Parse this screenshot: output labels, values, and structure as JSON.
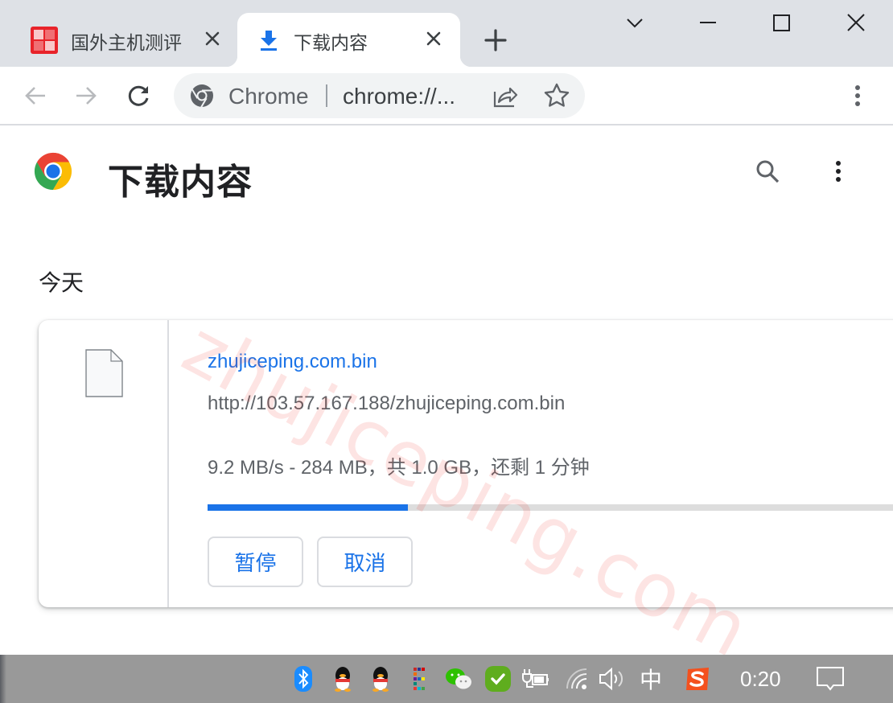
{
  "tabs": [
    {
      "title": "国外主机测评",
      "icon": "site-favicon",
      "active": false
    },
    {
      "title": "下载内容",
      "icon": "download-icon",
      "active": true
    }
  ],
  "window_controls": [
    "tab-search",
    "minimize",
    "maximize",
    "close"
  ],
  "toolbar": {
    "omnibox_chip": "Chrome",
    "omnibox_url": "chrome://..."
  },
  "page": {
    "title": "下载内容",
    "section_label": "今天"
  },
  "download": {
    "file_name": "zhujiceping.com.bin",
    "url": "http://103.57.167.188/zhujiceping.com.bin",
    "status": "9.2 MB/s - 284 MB，共 1.0 GB，还剩 1 分钟",
    "progress": 0.28,
    "pause_label": "暂停",
    "cancel_label": "取消"
  },
  "watermark": "zhujiceping.com",
  "colors": {
    "accent": "#1a73e8",
    "tabstrip": "#dee1e6",
    "taskbar": "#999999"
  },
  "taskbar": {
    "tray_icons": [
      "bluetooth-icon",
      "qq-icon",
      "qq-icon",
      "app-grid-icon",
      "wechat-icon",
      "security-check-icon",
      "power-battery-icon",
      "wifi-icon",
      "volume-icon",
      "ime-icon",
      "sogou-icon"
    ],
    "ime_label": "中",
    "clock": "0:20"
  }
}
